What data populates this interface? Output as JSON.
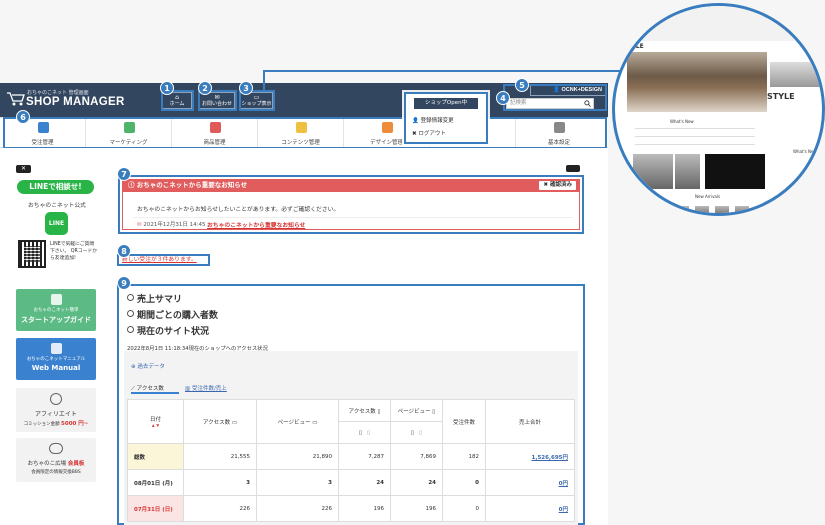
{
  "app": {
    "logo_sub": "おちゃのこネット 管理画面",
    "logo_main": "SHOP MANAGER"
  },
  "header_buttons": {
    "home": "ホーム",
    "contact": "お問い合わせ",
    "shop": "ショップ表示"
  },
  "account": {
    "name": "OCNK+DESIGN",
    "search_placeholder": "記検索"
  },
  "dropdown": {
    "status": "ショップOpen中",
    "items": [
      "登録情報変更",
      "ログアウト"
    ]
  },
  "nav": [
    "受注管理",
    "マーケティング",
    "商品管理",
    "コンテンツ管理",
    "デザイン管理",
    "",
    "基本設定"
  ],
  "sidebar": {
    "close": "✕",
    "line_button": "LINEで相談せ!",
    "line_title": "おちゃのこネット公式",
    "line_logo": "LINE",
    "qr_text": "LINEで気軽にご質問下さい。 QRコードから友達追加!",
    "start_sub": "おちゃのこネット簡単",
    "start_main": "スタートアップガイド",
    "manual_sub": "おちゃのこネットマニュアル",
    "manual_main": "Web Manual",
    "affiliate": "アフィリエイト",
    "affiliate_sub": "コミッション金額",
    "affiliate_amount": "5000 円~",
    "bbs_main": "おちゃのこ広場",
    "bbs_badge": "会員板",
    "bbs_sub": "会員限定の情報交換BBS"
  },
  "notice": {
    "title": "おちゃのこネットから重要なお知らせ",
    "confirm": "確認済み",
    "message": "おちゃのこネットからお知らせしたいことがあります。必ずご確認ください。",
    "date": "2021年12月31日 14:45",
    "link": "おちゃのこネットから重要なお知らせ"
  },
  "unread_orders": "新しい受注が３件あります。",
  "sections": [
    "売上サマリ",
    "期間ごとの購入者数",
    "現在のサイト状況"
  ],
  "timestamp": "2022年8月1日 11:18:34現在のショップへのアクセス状況",
  "past_data": "過去データ",
  "tabs": [
    "アクセス数",
    "受注件数/売上"
  ],
  "table": {
    "headers": [
      "日付",
      "アクセス数",
      "ページビュー",
      "アクセス数",
      "ページビュー",
      "受注件数",
      "売上合計"
    ],
    "rows": [
      {
        "label": "総数",
        "cells": [
          "21,555",
          "21,890",
          "7,287",
          "7,869",
          "182",
          "1,526,695円"
        ]
      },
      {
        "label": "08月01日 (月)",
        "cells": [
          "3",
          "3",
          "24",
          "24",
          "0",
          "0円"
        ]
      },
      {
        "label": "07月31日 (日)",
        "cells": [
          "226",
          "226",
          "196",
          "196",
          "0",
          "0円"
        ]
      }
    ]
  },
  "badges": [
    "1",
    "2",
    "3",
    "4",
    "5",
    "6",
    "7",
    "8",
    "9"
  ],
  "preview": {
    "logo": "STYLE",
    "logo2": "STYLE",
    "whats_new": "What's New",
    "new_arrivals": "New Arrivals",
    "whats2": "What's Ne"
  },
  "colors": {
    "header": "#33465f",
    "accent": "#3a7dbf",
    "alert": "#e15c5c",
    "line": "#28b446"
  }
}
